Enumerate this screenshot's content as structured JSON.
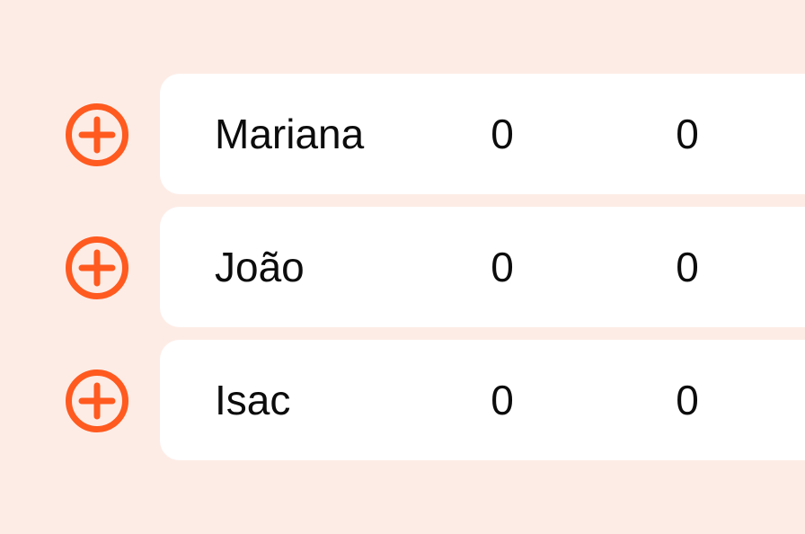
{
  "colors": {
    "background": "#fdece6",
    "card": "#ffffff",
    "accent": "#ff5a1f",
    "text": "#0c0c0c"
  },
  "players": [
    {
      "name": "Mariana",
      "values": [
        "0",
        "0"
      ],
      "add_icon": "plus-circle-icon"
    },
    {
      "name": "João",
      "values": [
        "0",
        "0"
      ],
      "add_icon": "plus-circle-icon"
    },
    {
      "name": "Isac",
      "values": [
        "0",
        "0"
      ],
      "add_icon": "plus-circle-icon"
    }
  ]
}
